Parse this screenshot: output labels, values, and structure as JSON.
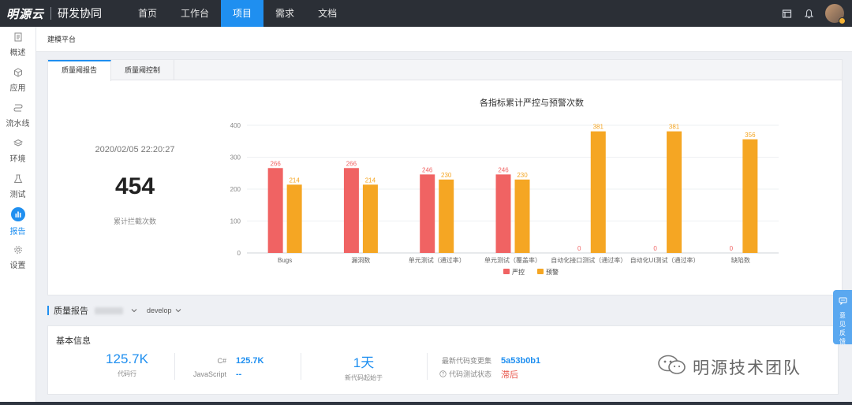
{
  "app": {
    "brand": "明源云",
    "product": "研发协同"
  },
  "nav": [
    {
      "label": "首页",
      "active": false
    },
    {
      "label": "工作台",
      "active": false
    },
    {
      "label": "项目",
      "active": true
    },
    {
      "label": "需求",
      "active": false
    },
    {
      "label": "文档",
      "active": false
    }
  ],
  "top_icons": [
    "window-icon",
    "bell-icon",
    "avatar"
  ],
  "sidebar": [
    {
      "label": "概述",
      "icon": "document-icon"
    },
    {
      "label": "应用",
      "icon": "cube-icon"
    },
    {
      "label": "流水线",
      "icon": "pipeline-icon"
    },
    {
      "label": "环境",
      "icon": "layers-icon"
    },
    {
      "label": "测试",
      "icon": "flask-icon"
    },
    {
      "label": "报告",
      "icon": "bar-chart-icon",
      "active": true
    },
    {
      "label": "设置",
      "icon": "gear-icon"
    }
  ],
  "breadcrumb": "建模平台",
  "tabs": [
    {
      "label": "质量阈报告",
      "active": true
    },
    {
      "label": "质量阈控制",
      "active": false
    }
  ],
  "stat": {
    "time": "2020/02/05 22:20:27",
    "value": "454",
    "label": "累计拦截次数"
  },
  "chart_data": {
    "type": "bar",
    "title": "各指标累计严控与预警次数",
    "categories": [
      "Bugs",
      "漏洞数",
      "单元测试（通过率）",
      "单元测试（覆盖率）",
      "自动化接口测试（通过率）",
      "自动化UI测试（通过率）",
      "缺陷数"
    ],
    "series": [
      {
        "name": "严控",
        "values": [
          266,
          266,
          246,
          246,
          0,
          0,
          0
        ],
        "color": "#f06363"
      },
      {
        "name": "预警",
        "values": [
          214,
          214,
          230,
          230,
          381,
          381,
          356
        ],
        "color": "#f5a623"
      }
    ],
    "ylim": [
      0,
      400
    ],
    "yticks": [
      0,
      100,
      200,
      300,
      400
    ],
    "grid": true,
    "legend": "bottom"
  },
  "quality_report": {
    "title": "质量报告",
    "branch": "develop"
  },
  "basic_info": {
    "title": "基本信息",
    "lines_value": "125.7K",
    "lines_label": "代码行",
    "languages": [
      {
        "name": "C#",
        "value": "125.7K"
      },
      {
        "name": "JavaScript",
        "value": "--"
      }
    ],
    "new_code_value": "1天",
    "new_code_label": "新代码起始于",
    "latest_change_label": "最新代码变更集",
    "latest_change_value": "5a53b0b1",
    "test_status_label": "代码测试状态",
    "test_status_value": "滞后"
  },
  "feedback": "意见反馈",
  "watermark": "明源技术团队"
}
